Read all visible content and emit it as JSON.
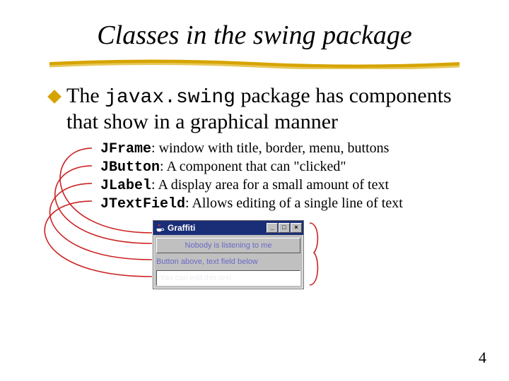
{
  "title": "Classes in the swing package",
  "bullet": {
    "prefix": "The ",
    "package": "javax.swing",
    "suffix": " package has components that show in a graphical manner"
  },
  "components": [
    {
      "name": "JFrame",
      "desc": ": window with title, border, menu, buttons"
    },
    {
      "name": "JButton",
      "desc": ": A component that can \"clicked\""
    },
    {
      "name": "JLabel",
      "desc": ": A display area for a small amount of text"
    },
    {
      "name": "JTextField",
      "desc": ": Allows editing of a single line of text"
    }
  ],
  "window": {
    "title": "Graffiti",
    "minimize": "_",
    "maximize": "□",
    "close": "×",
    "button_label": "Nobody is listening to me",
    "label_text": "Button above, text field below",
    "textfield_value": "You can edit this text"
  },
  "page_number": "4"
}
